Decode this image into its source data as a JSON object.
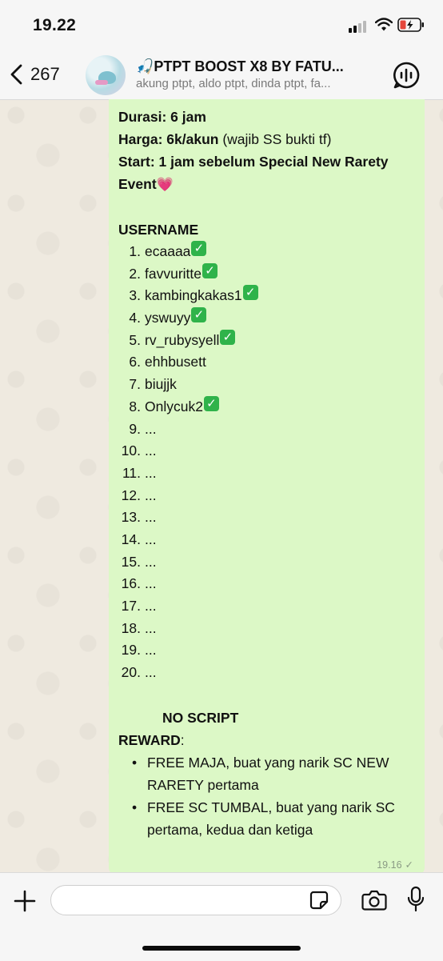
{
  "status_bar": {
    "time": "19.22",
    "icons": [
      "signal-icon",
      "wifi-icon",
      "battery-charging-icon"
    ]
  },
  "header": {
    "back_count": "267",
    "title": "🎣PTPT BOOST X8 BY FATU...",
    "subtitle": "akung ptpt, aldo ptpt, dinda ptpt, fa...",
    "icons": [
      "chevron-left-icon",
      "group-avatar-icon",
      "voice-chat-icon"
    ]
  },
  "message": {
    "durasi_label": "Durasi: 6 jam",
    "harga_label": "Harga: 6k/akun",
    "harga_note": " (wajib SS bukti tf)",
    "start_label": "Start: 1 jam sebelum Special New Rarety Event",
    "heart": "💗",
    "username_heading": "USERNAME",
    "users": [
      {
        "num": "1.",
        "name": "ecaaaa",
        "checked": true
      },
      {
        "num": "2.",
        "name": "favvuritte",
        "checked": true
      },
      {
        "num": "3.",
        "name": "kambingkakas1",
        "checked": true
      },
      {
        "num": "4.",
        "name": "yswuyy",
        "checked": true
      },
      {
        "num": "5.",
        "name": "rv_rubysyell",
        "checked": true
      },
      {
        "num": "6.",
        "name": "ehhbusett",
        "checked": false
      },
      {
        "num": "7.",
        "name": "biujjk",
        "checked": false
      },
      {
        "num": "8.",
        "name": "Onlycuk2",
        "checked": true
      },
      {
        "num": "9.",
        "name": "...",
        "checked": false
      },
      {
        "num": "10.",
        "name": "...",
        "checked": false
      },
      {
        "num": "11.",
        "name": "...",
        "checked": false
      },
      {
        "num": "12.",
        "name": "...",
        "checked": false
      },
      {
        "num": "13.",
        "name": "...",
        "checked": false
      },
      {
        "num": "14.",
        "name": "...",
        "checked": false
      },
      {
        "num": "15.",
        "name": "...",
        "checked": false
      },
      {
        "num": "16.",
        "name": "...",
        "checked": false
      },
      {
        "num": "17.",
        "name": "...",
        "checked": false
      },
      {
        "num": "18.",
        "name": "...",
        "checked": false
      },
      {
        "num": "19.",
        "name": "...",
        "checked": false
      },
      {
        "num": "20.",
        "name": "...",
        "checked": false
      }
    ],
    "check_glyph": "✓",
    "no_script": "NO SCRIPT",
    "reward_heading": "REWARD",
    "reward_colon": ":",
    "rewards": [
      "FREE MAJA, buat yang narik SC NEW RARETY pertama",
      "FREE SC TUMBAL, buat yang narik SC pertama, kedua dan ketiga"
    ],
    "timestamp": "19.16",
    "sent_tick": "✓"
  },
  "composer": {
    "input_value": "",
    "input_placeholder": "",
    "icons": [
      "plus-icon",
      "sticker-icon",
      "camera-icon",
      "microphone-icon"
    ]
  },
  "colors": {
    "bubble": "#dcf8c6",
    "chat_bg": "#efeae0",
    "check_green": "#2fb34a",
    "bars": "#f6f6f6"
  }
}
